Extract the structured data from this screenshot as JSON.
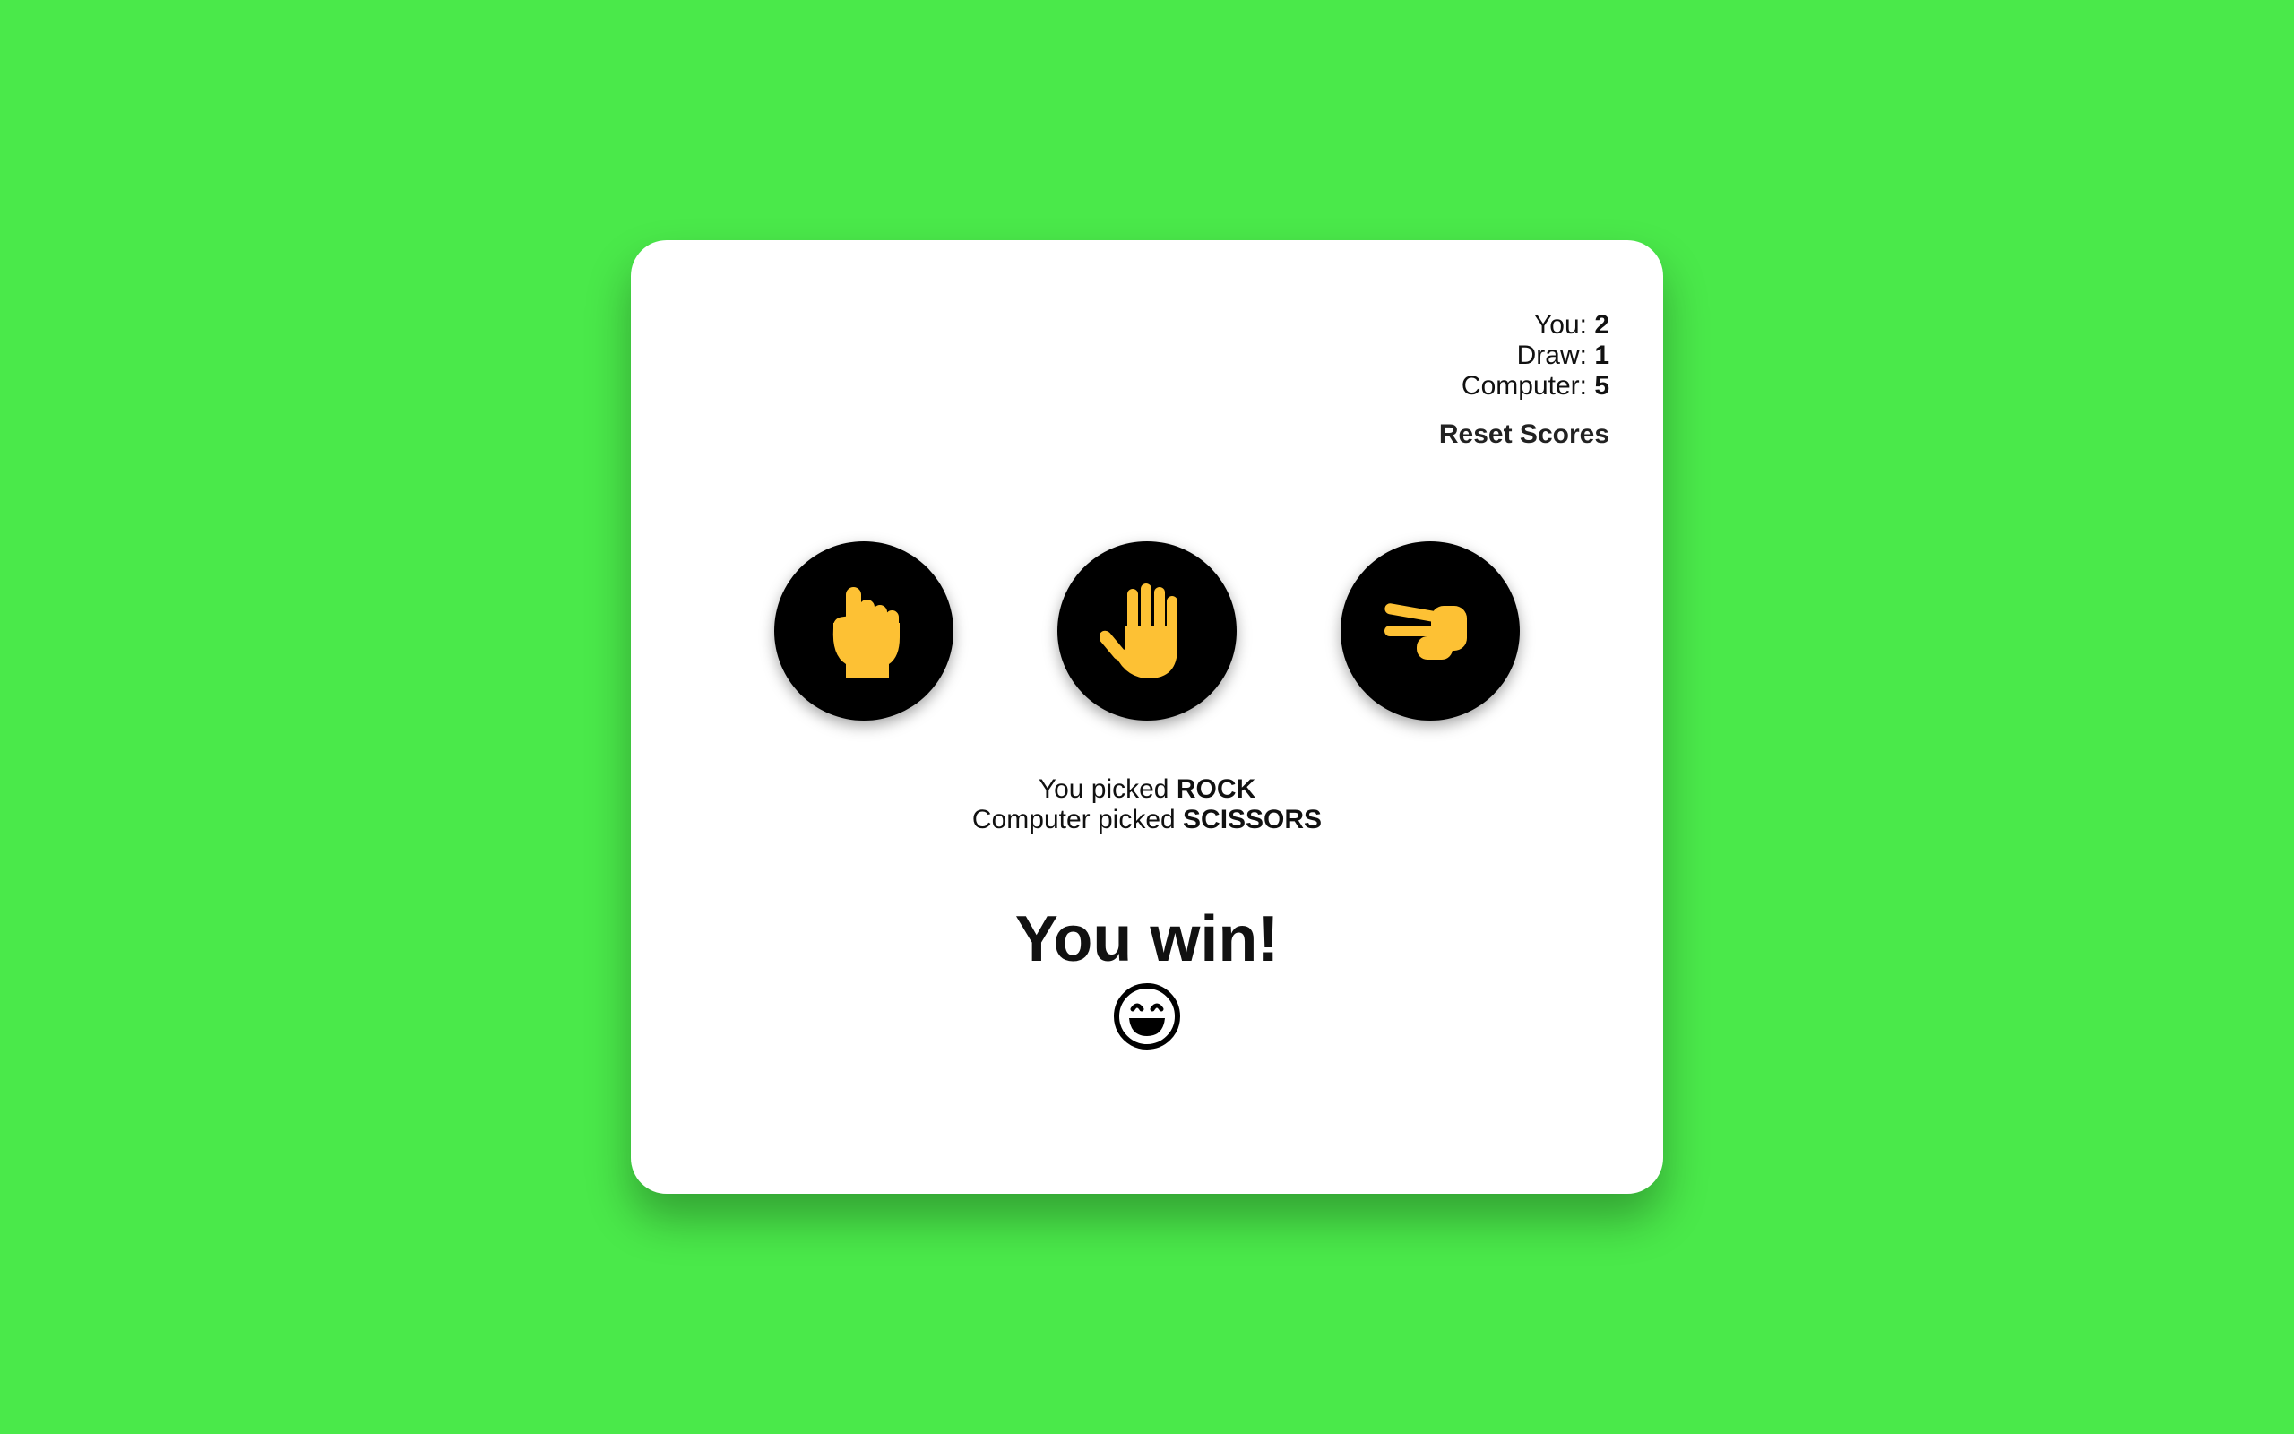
{
  "scores": {
    "you_label": "You: ",
    "you_value": "2",
    "draw_label": "Draw: ",
    "draw_value": "1",
    "computer_label": "Computer: ",
    "computer_value": "5"
  },
  "reset_label": "Reset Scores",
  "choices": [
    {
      "name": "rock",
      "icon": "raised-fist-icon"
    },
    {
      "name": "paper",
      "icon": "raised-hand-icon"
    },
    {
      "name": "scissors",
      "icon": "victory-hand-icon"
    }
  ],
  "picks": {
    "you_prefix": "You picked ",
    "you_choice": "ROCK",
    "computer_prefix": "Computer picked ",
    "computer_choice": "SCISSORS"
  },
  "result": {
    "message": "You win!",
    "icon": "grinning-face-icon"
  },
  "colors": {
    "background": "#4ae94a",
    "card": "#ffffff",
    "button": "#000000",
    "hand": "#fdc134"
  }
}
